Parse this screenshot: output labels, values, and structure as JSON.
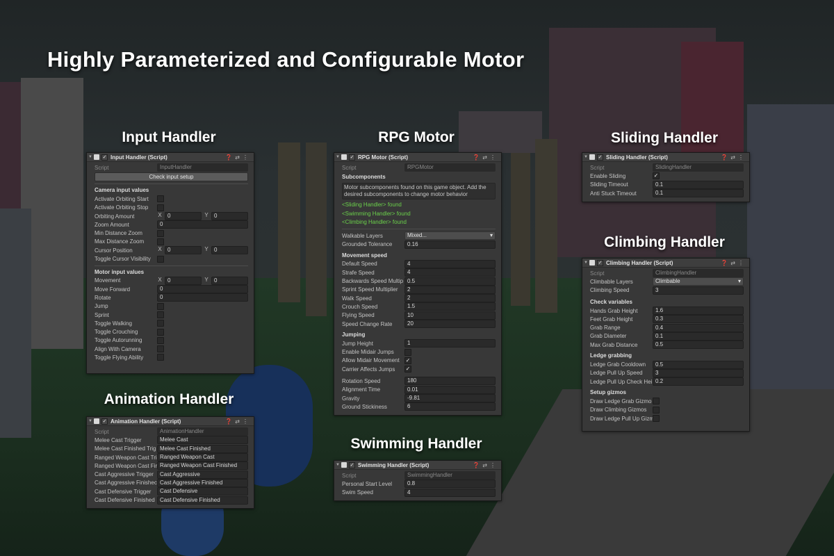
{
  "title": "Highly Parameterized and Configurable Motor",
  "sections": {
    "input": "Input Handler",
    "rpg": "RPG Motor",
    "sliding": "Sliding Handler",
    "climbing": "Climbing Handler",
    "animation": "Animation Handler",
    "swimming": "Swimming Handler"
  },
  "common": {
    "script_label": "Script"
  },
  "input_panel": {
    "header": "Input Handler (Script)",
    "script": "InputHandler",
    "button": "Check input setup",
    "camera_section": "Camera input values",
    "motor_section": "Motor input values",
    "rows": {
      "activate_orbiting_start": "Activate Orbiting Start",
      "activate_orbiting_stop": "Activate Orbiting Stop",
      "orbiting_amount": {
        "label": "Orbiting Amount",
        "x": "0",
        "y": "0"
      },
      "zoom_amount": {
        "label": "Zoom Amount",
        "value": "0"
      },
      "min_distance_zoom": "Min Distance Zoom",
      "max_distance_zoom": "Max Distance Zoom",
      "cursor_position": {
        "label": "Cursor Position",
        "x": "0",
        "y": "0"
      },
      "toggle_cursor_visibility": "Toggle Cursor Visibility",
      "movement": {
        "label": "Movement",
        "x": "0",
        "y": "0"
      },
      "move_forward": {
        "label": "Move Forward",
        "value": "0"
      },
      "rotate": {
        "label": "Rotate",
        "value": "0"
      },
      "jump": "Jump",
      "sprint": "Sprint",
      "toggle_walking": "Toggle Walking",
      "toggle_crouching": "Toggle Crouching",
      "toggle_autorunning": "Toggle Autorunning",
      "align_with_camera": "Align With Camera",
      "toggle_flying_ability": "Toggle Flying Ability"
    }
  },
  "rpg_panel": {
    "header": "RPG Motor (Script)",
    "script": "RPGMotor",
    "subcomponents_section": "Subcomponents",
    "help_text": "Motor subcomponents found on this game object. Add the desired subcomponents to change motor behavior",
    "found": [
      "<Sliding Handler> found",
      "<Swimming Handler> found",
      "<Climbing Handler> found"
    ],
    "walkable_layers": {
      "label": "Walkable Layers",
      "value": "Mixed..."
    },
    "grounded_tolerance": {
      "label": "Grounded Tolerance",
      "value": "0.16"
    },
    "movement_speed_section": "Movement speed",
    "movement_rows": [
      {
        "label": "Default Speed",
        "value": "4"
      },
      {
        "label": "Strafe Speed",
        "value": "4"
      },
      {
        "label": "Backwards Speed Multip",
        "value": "0.5"
      },
      {
        "label": "Sprint Speed Multiplier",
        "value": "2"
      },
      {
        "label": "Walk Speed",
        "value": "2"
      },
      {
        "label": "Crouch Speed",
        "value": "1.5"
      },
      {
        "label": "Flying Speed",
        "value": "10"
      },
      {
        "label": "Speed Change Rate",
        "value": "20"
      }
    ],
    "jumping_section": "Jumping",
    "jump_height": {
      "label": "Jump Height",
      "value": "1"
    },
    "enable_midair_jumps": "Enable Midair Jumps",
    "allow_midair_movement": "Allow Midair Movement",
    "carrier_affects_jumps": "Carrier Affects Jumps",
    "physics_rows": [
      {
        "label": "Rotation Speed",
        "value": "180"
      },
      {
        "label": "Alignment Time",
        "value": "0.01"
      },
      {
        "label": "Gravity",
        "value": "-9.81"
      },
      {
        "label": "Ground Stickiness",
        "value": "6"
      }
    ]
  },
  "sliding_panel": {
    "header": "Sliding Handler (Script)",
    "script": "SlidingHandler",
    "enable_sliding": "Enable Sliding",
    "sliding_timeout": {
      "label": "Sliding Timeout",
      "value": "0.1"
    },
    "anti_stuck_timeout": {
      "label": "Anti Stuck Timeout",
      "value": "0.1"
    }
  },
  "climbing_panel": {
    "header": "Climbing Handler (Script)",
    "script": "ClimbingHandler",
    "climbable_layers": {
      "label": "Climbable Layers",
      "value": "Climbable"
    },
    "climbing_speed": {
      "label": "Climbing Speed",
      "value": "3"
    },
    "check_section": "Check variables",
    "check_rows": [
      {
        "label": "Hands Grab Height",
        "value": "1.6"
      },
      {
        "label": "Feet Grab Height",
        "value": "0.3"
      },
      {
        "label": "Grab Range",
        "value": "0.4"
      },
      {
        "label": "Grab Diameter",
        "value": "0.1"
      },
      {
        "label": "Max Grab Distance",
        "value": "0.5"
      }
    ],
    "ledge_section": "Ledge grabbing",
    "ledge_rows": [
      {
        "label": "Ledge Grab Cooldown",
        "value": "0.5"
      },
      {
        "label": "Ledge Pull Up Speed",
        "value": "3"
      },
      {
        "label": "Ledge Pull Up Check Hei",
        "value": "0.2"
      }
    ],
    "gizmos_section": "Setup gizmos",
    "gizmo_rows": [
      "Draw Ledge Grab Gizmo",
      "Draw Climbing Gizmos",
      "Draw Ledge Pull Up Gizm"
    ]
  },
  "animation_panel": {
    "header": "Animation Handler (Script)",
    "script": "AnimationHandler",
    "rows": [
      {
        "label": "Melee Cast Trigger",
        "value": "Melee Cast"
      },
      {
        "label": "Melee Cast Finished Trig",
        "value": "Melee Cast Finished"
      },
      {
        "label": "Ranged Weapon Cast Tri",
        "value": "Ranged Weapon Cast"
      },
      {
        "label": "Ranged Weapon Cast Fir",
        "value": "Ranged Weapon Cast Finished"
      },
      {
        "label": "Cast Aggressive Trigger",
        "value": "Cast Aggressive"
      },
      {
        "label": "Cast Aggressive Finishec",
        "value": "Cast Aggressive Finished"
      },
      {
        "label": "Cast Defensive Trigger",
        "value": "Cast Defensive"
      },
      {
        "label": "Cast Defensive Finished",
        "value": "Cast Defensive Finished"
      }
    ]
  },
  "swimming_panel": {
    "header": "Swimming Handler (Script)",
    "script": "SwimmingHandler",
    "personal_start_level": {
      "label": "Personal Start Level",
      "value": "0.8"
    },
    "swim_speed": {
      "label": "Swim Speed",
      "value": "4"
    }
  },
  "icons": {
    "header": [
      "foldout-triangle-icon",
      "script-icon",
      "enabled-checkbox",
      "help-icon",
      "preset-icon",
      "kebab-menu-icon"
    ],
    "script_field": "target-icon",
    "check": "✓"
  },
  "colors": {
    "panel_bg": "#383838",
    "field_bg": "#2a2a2a",
    "found_text": "#6bd14b"
  }
}
